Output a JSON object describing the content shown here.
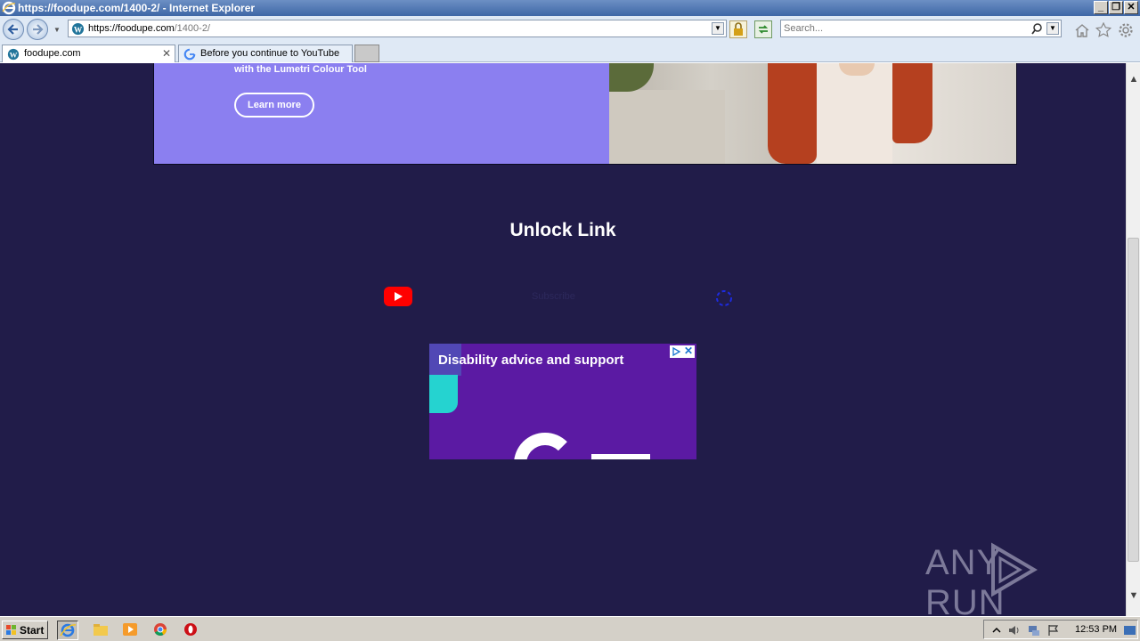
{
  "window": {
    "title": "https://foodupe.com/1400-2/ - Internet Explorer",
    "controls": {
      "minimize": "_",
      "maximize": "❐",
      "close": "✕"
    }
  },
  "address_bar": {
    "url_host": "https://foodupe.com",
    "url_path": "/1400-2/"
  },
  "search": {
    "placeholder": "Search..."
  },
  "tabs": [
    {
      "label": "foodupe.com",
      "active": true,
      "icon": "wordpress-icon"
    },
    {
      "label": "Before you continue to YouTube",
      "active": false,
      "icon": "google-icon"
    }
  ],
  "page": {
    "banner": {
      "text": "with the Lumetri Colour Tool",
      "button": "Learn more",
      "bg_color": "#8b7ff0"
    },
    "heading": "Unlock Link",
    "subscribe_text": "Subscribe",
    "ad": {
      "title": "Disability advice and support",
      "bg_color": "#5b1aa3"
    },
    "background_color": "#211c49"
  },
  "watermark": {
    "left": "ANY",
    "right": "RUN"
  },
  "taskbar": {
    "start_label": "Start",
    "clock": "12:53 PM",
    "apps": [
      "internet-explorer-icon",
      "file-explorer-icon",
      "media-player-icon",
      "chrome-icon",
      "opera-icon"
    ]
  }
}
